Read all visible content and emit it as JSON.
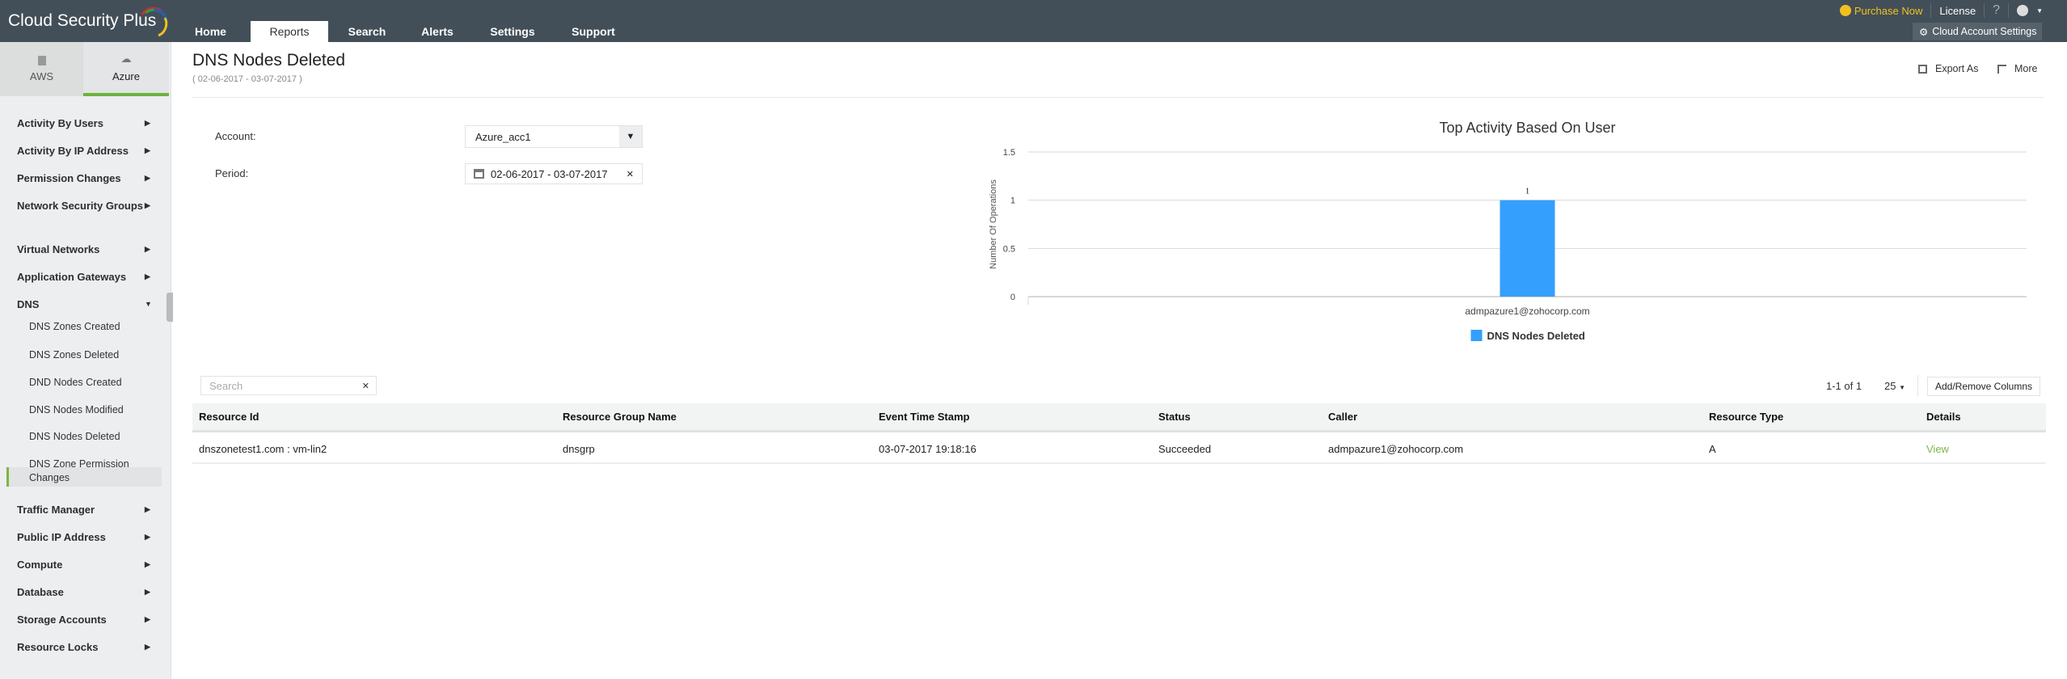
{
  "app": {
    "title": "Cloud Security Plus"
  },
  "nav": {
    "tabs": [
      {
        "label": "Home"
      },
      {
        "label": "Reports",
        "active": true
      },
      {
        "label": "Search"
      },
      {
        "label": "Alerts"
      },
      {
        "label": "Settings"
      },
      {
        "label": "Support"
      }
    ]
  },
  "toplinks": {
    "purchase": "Purchase Now",
    "license": "License",
    "help": "?",
    "cloud_settings": "Cloud Account Settings"
  },
  "cloud_tabs": {
    "aws": "AWS",
    "azure": "Azure"
  },
  "sidebar": {
    "items": [
      {
        "label": "Activity By Users"
      },
      {
        "label": "Activity By IP Address"
      },
      {
        "label": "Permission Changes"
      },
      {
        "label": "Network Security Groups"
      },
      {
        "label": "Virtual Networks"
      },
      {
        "label": "Application Gateways"
      },
      {
        "label": "DNS"
      },
      {
        "label": "Traffic Manager"
      },
      {
        "label": "Public IP Address"
      },
      {
        "label": "Compute"
      },
      {
        "label": "Database"
      },
      {
        "label": "Storage Accounts"
      },
      {
        "label": "Resource Locks"
      }
    ],
    "dns_sub": [
      {
        "label": "DNS Zones Created"
      },
      {
        "label": "DNS Zones Deleted"
      },
      {
        "label": "DND Nodes Created"
      },
      {
        "label": "DNS Nodes Modified"
      },
      {
        "label": "DNS Nodes Deleted",
        "active": true
      },
      {
        "label": "DNS Zone Permission Changes"
      }
    ]
  },
  "page": {
    "title": "DNS Nodes Deleted",
    "date_range": "( 02-06-2017 - 03-07-2017 )",
    "export": "Export As",
    "more": "More"
  },
  "filters": {
    "account_label": "Account:",
    "account_value": "Azure_acc1",
    "period_label": "Period:",
    "period_value": "02-06-2017 - 03-07-2017"
  },
  "chart_data": {
    "type": "bar",
    "title": "Top Activity Based On User",
    "ylabel": "Number Of Operations",
    "xlabel": "",
    "categories": [
      "admpazure1@zohocorp.com"
    ],
    "series": [
      {
        "name": "DNS Nodes Deleted",
        "values": [
          1
        ]
      }
    ],
    "ylim": [
      0,
      1.5
    ],
    "yticks": [
      "0",
      "0.5",
      "1",
      "1.5"
    ],
    "grid": true,
    "legend": "bottom",
    "color": "#349ffc"
  },
  "table": {
    "search_placeholder": "Search",
    "pager": "1-1 of 1",
    "per_page": "25",
    "add_remove": "Add/Remove Columns",
    "columns": [
      "Resource Id",
      "Resource Group Name",
      "Event Time Stamp",
      "Status",
      "Caller",
      "Resource Type",
      "Details"
    ],
    "rows": [
      [
        "dnszonetest1.com : vm-lin2",
        "dnsgrp",
        "03-07-2017 19:18:16",
        "Succeeded",
        "admpazure1@zohocorp.com",
        "A",
        "View"
      ]
    ]
  },
  "colors": {
    "topbar": "#434f58",
    "accent_green": "#7ab648",
    "bar": "#349ffc",
    "purchase": "#f2c01e"
  }
}
